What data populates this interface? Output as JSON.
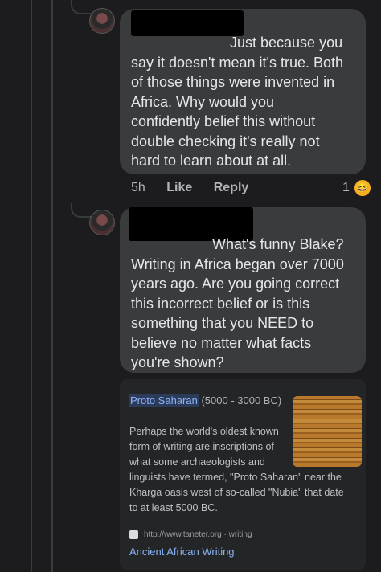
{
  "comments": [
    {
      "text": "Just because you\nsay it doesn't mean it's true. Both\nof those things were invented in\nAfrica. Why would you\nconfidently belief this without\ndouble checking it's really not\nhard to learn about at all.",
      "time": "5h",
      "like_label": "Like",
      "reply_label": "Reply",
      "reaction_count": "1",
      "reaction_icon": "laughing-emoji"
    },
    {
      "text": "What's funny Blake?\nWriting in Africa began over 7000\nyears ago. Are you going correct\nthis incorrect belief or is this\nsomething that you NEED to\nbelieve no matter what facts\nyou're shown?"
    }
  ],
  "link_card": {
    "title": "Proto Saharan",
    "title_range": "(5000 - 3000 BC)",
    "body": "Perhaps the world's oldest known\nform of writing are inscriptions of\nwhat some archaeologists and\nlinguists have termed, \"Proto Saharan\" near the\nKharga oasis west of so-called \"Nubia\" that date\nto at least 5000 BC.",
    "source": "http://www.taneter.org · writing",
    "link_text": "Ancient African Writing"
  },
  "colors": {
    "background": "#1c1c1e",
    "bubble": "#3a3b3c",
    "link": "#8ab4f8"
  }
}
